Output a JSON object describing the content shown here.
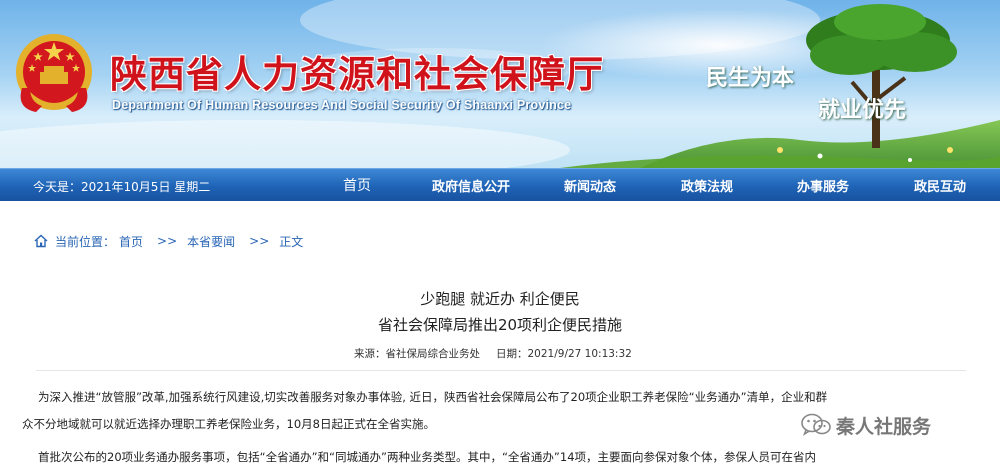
{
  "header": {
    "title": "陕西省人力资源和社会保障厅",
    "subtitle": "Department Of Human Resources And Social Security Of Shaanxi Province",
    "slogan_line1": "民生为本",
    "slogan_line2": "就业优先"
  },
  "navbar": {
    "date": "今天是：2021年10月5日 星期二",
    "items": [
      {
        "label": "首页"
      },
      {
        "label": "政府信息公开"
      },
      {
        "label": "新闻动态"
      },
      {
        "label": "政策法规"
      },
      {
        "label": "办事服务"
      },
      {
        "label": "政民互动"
      }
    ]
  },
  "breadcrumb": {
    "current": "当前位置：",
    "home": "首页",
    "sep1": ">>",
    "section": "本省要闻",
    "sep2": ">>",
    "page": "正文"
  },
  "article": {
    "title_line1": "少跑腿 就近办 利企便民",
    "title_line2": "省社会保障局推出20项利企便民措施",
    "source": "来源：省社保局综合业务处",
    "date": "日期：2021/9/27 10:13:32",
    "para1_line1": "为深入推进“放管服”改革,加强系统行风建设,切实改善服务对象办事体验, 近日，陕西省社会保障局公布了20项企业职工养老保险“业务通办”清单，企业和群",
    "para1_line2": "众不分地域就可以就近选择办理职工养老保险业务，10月8日起正式在全省实施。",
    "para2_line1": "首批次公布的20项业务通办服务事项，包括“全省通办”和“同城通办”两种业务类型。其中，“全省通办”14项，主要面向参保对象个体，参保人员可在省内"
  },
  "watermark": {
    "text": "秦人社服务",
    "icon": "wechat-icon"
  },
  "colors": {
    "title_red": "#d0121b",
    "nav_blue": "#1f63b6",
    "link_blue": "#2a66b5"
  }
}
